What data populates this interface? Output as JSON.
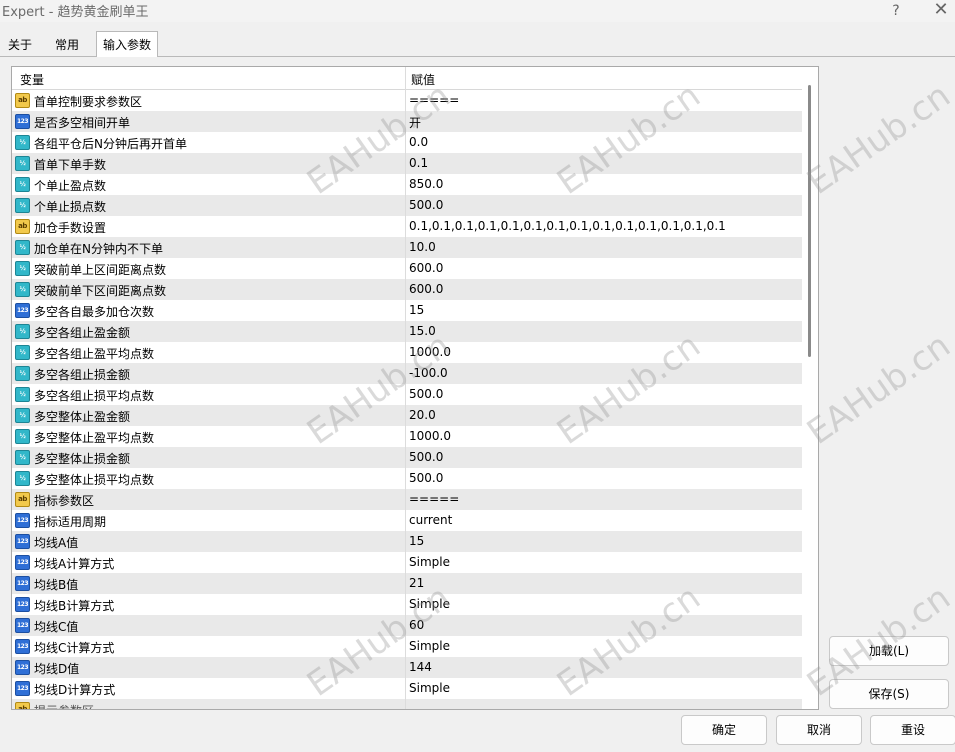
{
  "window": {
    "title": "Expert - 趋势黄金刷单王",
    "help_label": "?",
    "close_label": "✕"
  },
  "tabs": [
    {
      "label": "关于"
    },
    {
      "label": "常用"
    },
    {
      "label": "输入参数",
      "active": true
    }
  ],
  "table": {
    "headers": {
      "variable": "变量",
      "value": "赋值"
    },
    "rows": [
      {
        "type": "ab",
        "name": "首单控制要求参数区",
        "value": "====="
      },
      {
        "type": "123",
        "name": "是否多空相间开单",
        "value": "开"
      },
      {
        "type": "v12",
        "name": "各组平仓后N分钟后再开首单",
        "value": "0.0"
      },
      {
        "type": "v12",
        "name": "首单下单手数",
        "value": "0.1"
      },
      {
        "type": "v12",
        "name": "个单止盈点数",
        "value": "850.0"
      },
      {
        "type": "v12",
        "name": "个单止损点数",
        "value": "500.0"
      },
      {
        "type": "ab",
        "name": "加仓手数设置",
        "value": "0.1,0.1,0.1,0.1,0.1,0.1,0.1,0.1,0.1,0.1,0.1,0.1,0.1,0.1"
      },
      {
        "type": "v12",
        "name": "加仓单在N分钟内不下单",
        "value": "10.0"
      },
      {
        "type": "v12",
        "name": "突破前单上区间距离点数",
        "value": "600.0"
      },
      {
        "type": "v12",
        "name": "突破前单下区间距离点数",
        "value": "600.0"
      },
      {
        "type": "123",
        "name": "多空各自最多加仓次数",
        "value": "15"
      },
      {
        "type": "v12",
        "name": "多空各组止盈金额",
        "value": "15.0"
      },
      {
        "type": "v12",
        "name": "多空各组止盈平均点数",
        "value": "1000.0"
      },
      {
        "type": "v12",
        "name": "多空各组止损金额",
        "value": "-100.0"
      },
      {
        "type": "v12",
        "name": "多空各组止损平均点数",
        "value": "500.0"
      },
      {
        "type": "v12",
        "name": "多空整体止盈金额",
        "value": "20.0"
      },
      {
        "type": "v12",
        "name": "多空整体止盈平均点数",
        "value": "1000.0"
      },
      {
        "type": "v12",
        "name": "多空整体止损金额",
        "value": "500.0"
      },
      {
        "type": "v12",
        "name": "多空整体止损平均点数",
        "value": "500.0"
      },
      {
        "type": "ab",
        "name": "指标参数区",
        "value": "====="
      },
      {
        "type": "123",
        "name": "指标适用周期",
        "value": "current"
      },
      {
        "type": "123",
        "name": "均线A值",
        "value": "15"
      },
      {
        "type": "123",
        "name": "均线A计算方式",
        "value": "Simple"
      },
      {
        "type": "123",
        "name": "均线B值",
        "value": "21"
      },
      {
        "type": "123",
        "name": "均线B计算方式",
        "value": "Simple"
      },
      {
        "type": "123",
        "name": "均线C值",
        "value": "60"
      },
      {
        "type": "123",
        "name": "均线C计算方式",
        "value": "Simple"
      },
      {
        "type": "123",
        "name": "均线D值",
        "value": "144"
      },
      {
        "type": "123",
        "name": "均线D计算方式",
        "value": "Simple"
      },
      {
        "type": "ab",
        "name": "提示参数区",
        "value": ""
      }
    ]
  },
  "icon_labels": {
    "ab": "ab",
    "123": "123",
    "v12": "½"
  },
  "watermark": {
    "text": "EAHub.cn"
  },
  "buttons": {
    "load": "加载(L)",
    "save": "保存(S)",
    "ok": "确定",
    "cancel": "取消",
    "reset": "重设"
  }
}
